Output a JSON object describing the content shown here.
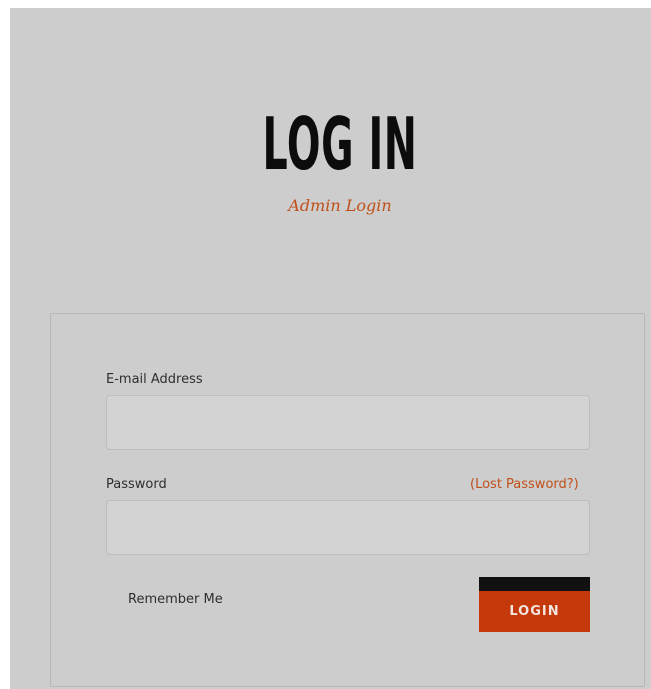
{
  "header": {
    "title": "LOG IN",
    "subtitle": "Admin Login"
  },
  "form": {
    "email_label": "E-mail Address",
    "email_value": "",
    "password_label": "Password",
    "password_value": "",
    "lost_password_link": "(Lost Password?)",
    "remember_label": "Remember Me",
    "login_button": "LOGIN"
  },
  "colors": {
    "background": "#cdcdcd",
    "accent": "#c0501a",
    "button": "#c5380a",
    "button_top_bar": "#111111"
  }
}
